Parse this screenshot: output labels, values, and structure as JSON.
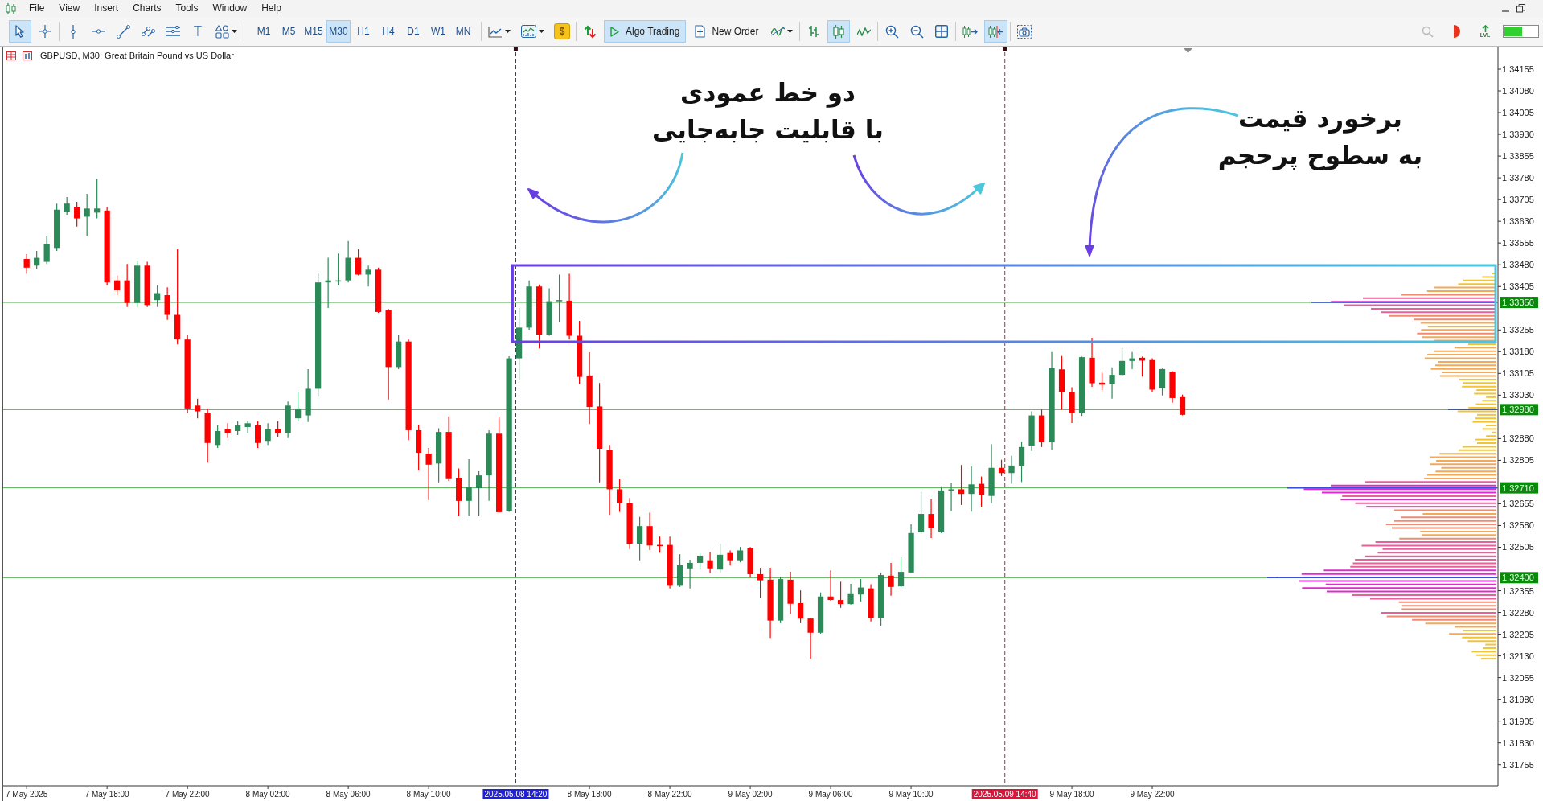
{
  "menu": {
    "items": [
      "File",
      "View",
      "Insert",
      "Charts",
      "Tools",
      "Window",
      "Help"
    ]
  },
  "toolbar": {
    "drawing_tools": [
      {
        "selected": true
      },
      {
        "selected": false
      },
      {
        "selected": false
      },
      {
        "selected": false
      },
      {
        "selected": false
      },
      {
        "selected": false
      },
      {
        "selected": false
      },
      {
        "selected": false,
        "glyph": "T"
      },
      {
        "selected": false
      }
    ],
    "timeframes": [
      {
        "label": "M1",
        "selected": false
      },
      {
        "label": "M5",
        "selected": false
      },
      {
        "label": "M15",
        "selected": false
      },
      {
        "label": "M30",
        "selected": true
      },
      {
        "label": "H1",
        "selected": false
      },
      {
        "label": "H4",
        "selected": false
      },
      {
        "label": "D1",
        "selected": false
      },
      {
        "label": "W1",
        "selected": false
      },
      {
        "label": "MN",
        "selected": false
      }
    ],
    "dollar_glyph": "$",
    "algo_trading": {
      "label": "Algo Trading",
      "on": true
    },
    "new_order": {
      "label": "New Order"
    },
    "chart_types": [
      {
        "selected": false
      },
      {
        "selected": true
      },
      {
        "selected": false
      }
    ],
    "scroll_tools": [
      {
        "on": false
      },
      {
        "on": true
      }
    ],
    "levels_label": "LVL"
  },
  "chart": {
    "title": "GBPUSD, M30: Great Britain Pound vs US Dollar",
    "chart_data": [
      {
        "type": "candlestick",
        "x": [
          "2025-05-07T14:00",
          "2025-05-07T14:30",
          "2025-05-07T15:00",
          "2025-05-07T15:30",
          "2025-05-07T16:00",
          "2025-05-07T16:30",
          "2025-05-07T17:00",
          "2025-05-07T17:30",
          "2025-05-07T18:00",
          "2025-05-07T18:30",
          "2025-05-07T19:00",
          "2025-05-07T19:30",
          "2025-05-07T20:00",
          "2025-05-07T20:30",
          "2025-05-07T21:00",
          "2025-05-07T21:30",
          "2025-05-07T22:00",
          "2025-05-07T22:30",
          "2025-05-07T23:00",
          "2025-05-07T23:30",
          "2025-05-08T00:00",
          "2025-05-08T00:30",
          "2025-05-08T01:00",
          "2025-05-08T01:30",
          "2025-05-08T02:00",
          "2025-05-08T02:30",
          "2025-05-08T03:00",
          "2025-05-08T03:30",
          "2025-05-08T04:00",
          "2025-05-08T04:30",
          "2025-05-08T05:00",
          "2025-05-08T05:30",
          "2025-05-08T06:00",
          "2025-05-08T06:30",
          "2025-05-08T07:00",
          "2025-05-08T07:30",
          "2025-05-08T08:00",
          "2025-05-08T08:30",
          "2025-05-08T09:00",
          "2025-05-08T09:30",
          "2025-05-08T10:00",
          "2025-05-08T10:30",
          "2025-05-08T11:00",
          "2025-05-08T11:30",
          "2025-05-08T12:00",
          "2025-05-08T12:30",
          "2025-05-08T13:00",
          "2025-05-08T13:30",
          "2025-05-08T14:00",
          "2025-05-08T14:30",
          "2025-05-08T15:00",
          "2025-05-08T15:30",
          "2025-05-08T16:00",
          "2025-05-08T16:30",
          "2025-05-08T17:00",
          "2025-05-08T17:30",
          "2025-05-08T18:00",
          "2025-05-08T18:30",
          "2025-05-08T19:00",
          "2025-05-08T19:30",
          "2025-05-08T20:00",
          "2025-05-08T20:30",
          "2025-05-08T21:00",
          "2025-05-08T21:30",
          "2025-05-08T22:00",
          "2025-05-08T22:30",
          "2025-05-08T23:00",
          "2025-05-08T23:30",
          "2025-05-09T00:00",
          "2025-05-09T00:30",
          "2025-05-09T01:00",
          "2025-05-09T01:30",
          "2025-05-09T02:00",
          "2025-05-09T02:30",
          "2025-05-09T03:00",
          "2025-05-09T03:30",
          "2025-05-09T04:00",
          "2025-05-09T04:30",
          "2025-05-09T05:00",
          "2025-05-09T05:30",
          "2025-05-09T06:00",
          "2025-05-09T06:30",
          "2025-05-09T07:00",
          "2025-05-09T07:30",
          "2025-05-09T08:00",
          "2025-05-09T08:30",
          "2025-05-09T09:00",
          "2025-05-09T09:30",
          "2025-05-09T10:00",
          "2025-05-09T10:30",
          "2025-05-09T11:00",
          "2025-05-09T11:30",
          "2025-05-09T12:00",
          "2025-05-09T12:30",
          "2025-05-09T13:00",
          "2025-05-09T13:30",
          "2025-05-09T14:00",
          "2025-05-09T14:30",
          "2025-05-09T15:00",
          "2025-05-09T15:30",
          "2025-05-09T16:00",
          "2025-05-09T16:30",
          "2025-05-09T17:00",
          "2025-05-09T17:30",
          "2025-05-09T18:00",
          "2025-05-09T18:30",
          "2025-05-09T19:00",
          "2025-05-09T19:30",
          "2025-05-09T20:00",
          "2025-05-09T20:30",
          "2025-05-09T21:00",
          "2025-05-09T21:30",
          "2025-05-09T22:00",
          "2025-05-09T22:30",
          "2025-05-09T23:00",
          "2025-05-09T23:30"
        ],
        "ohlc": [
          [
            1.335,
            1.33517,
            1.33449,
            1.3347
          ],
          [
            1.33477,
            1.33528,
            1.33466,
            1.33504
          ],
          [
            1.3349,
            1.33578,
            1.33483,
            1.33551
          ],
          [
            1.33538,
            1.33691,
            1.33528,
            1.3367
          ],
          [
            1.33663,
            1.33714,
            1.33653,
            1.33691
          ],
          [
            1.3368,
            1.33697,
            1.33612,
            1.3364
          ],
          [
            1.33646,
            1.33725,
            1.33578,
            1.33674
          ],
          [
            1.3366,
            1.33776,
            1.3364,
            1.33674
          ],
          [
            1.33667,
            1.3368,
            1.33409,
            1.33419
          ],
          [
            1.33426,
            1.33443,
            1.33375,
            1.33392
          ],
          [
            1.33426,
            1.33483,
            1.33334,
            1.33348
          ],
          [
            1.33348,
            1.33494,
            1.33334,
            1.33477
          ],
          [
            1.33477,
            1.3349,
            1.33334,
            1.33341
          ],
          [
            1.33358,
            1.33409,
            1.33334,
            1.33382
          ],
          [
            1.33375,
            1.33402,
            1.3329,
            1.33307
          ],
          [
            1.33307,
            1.33534,
            1.33205,
            1.33222
          ],
          [
            1.33222,
            1.33239,
            1.32967,
            1.32984
          ],
          [
            1.32994,
            1.33018,
            1.3295,
            1.32974
          ],
          [
            1.32967,
            1.32984,
            1.32797,
            1.32865
          ],
          [
            1.32858,
            1.32926,
            1.32848,
            1.32906
          ],
          [
            1.32913,
            1.32933,
            1.32882,
            1.32899
          ],
          [
            1.32906,
            1.3294,
            1.32892,
            1.32926
          ],
          [
            1.3292,
            1.3294,
            1.32899,
            1.32933
          ],
          [
            1.32926,
            1.3294,
            1.32848,
            1.32865
          ],
          [
            1.32872,
            1.32933,
            1.32858,
            1.32913
          ],
          [
            1.32913,
            1.3294,
            1.32886,
            1.32899
          ],
          [
            1.32899,
            1.33008,
            1.32882,
            1.32994
          ],
          [
            1.3295,
            1.33042,
            1.3294,
            1.32984
          ],
          [
            1.3296,
            1.3312,
            1.32937,
            1.33052
          ],
          [
            1.33052,
            1.33453,
            1.33025,
            1.33419
          ],
          [
            1.33419,
            1.33504,
            1.33331,
            1.33426
          ],
          [
            1.33422,
            1.33519,
            1.33409,
            1.33426
          ],
          [
            1.33426,
            1.33562,
            1.33419,
            1.33504
          ],
          [
            1.33504,
            1.33534,
            1.33443,
            1.33446
          ],
          [
            1.33446,
            1.33477,
            1.33405,
            1.33463
          ],
          [
            1.33463,
            1.3347,
            1.33314,
            1.33317
          ],
          [
            1.33324,
            1.33327,
            1.33015,
            1.33127
          ],
          [
            1.33127,
            1.33239,
            1.3312,
            1.33215
          ],
          [
            1.33215,
            1.33222,
            1.32875,
            1.32909
          ],
          [
            1.32909,
            1.32928,
            1.3277,
            1.32831
          ],
          [
            1.32828,
            1.32848,
            1.32668,
            1.3279
          ],
          [
            1.32794,
            1.32916,
            1.32729,
            1.32903
          ],
          [
            1.32903,
            1.32957,
            1.32733,
            1.32743
          ],
          [
            1.32745,
            1.32777,
            1.32612,
            1.32665
          ],
          [
            1.32665,
            1.32809,
            1.32612,
            1.32712
          ],
          [
            1.32709,
            1.32767,
            1.32612,
            1.32753
          ],
          [
            1.32753,
            1.32909,
            1.32665,
            1.32897
          ],
          [
            1.32897,
            1.32954,
            1.32624,
            1.32626
          ],
          [
            1.32631,
            1.33164,
            1.32627,
            1.33157
          ],
          [
            1.33157,
            1.33331,
            1.33083,
            1.33263
          ],
          [
            1.33263,
            1.33426,
            1.33256,
            1.33405
          ],
          [
            1.33405,
            1.33412,
            1.33191,
            1.33239
          ],
          [
            1.33239,
            1.33399,
            1.33235,
            1.33354
          ],
          [
            1.33354,
            1.33446,
            1.33283,
            1.33358
          ],
          [
            1.33356,
            1.33449,
            1.33222,
            1.33235
          ],
          [
            1.33235,
            1.33286,
            1.33067,
            1.33093
          ],
          [
            1.33098,
            1.33178,
            1.3293,
            1.32989
          ],
          [
            1.32991,
            1.33072,
            1.32729,
            1.32845
          ],
          [
            1.32841,
            1.32858,
            1.32617,
            1.32705
          ],
          [
            1.32705,
            1.3274,
            1.32627,
            1.32657
          ],
          [
            1.32657,
            1.32675,
            1.32499,
            1.32517
          ],
          [
            1.32517,
            1.3261,
            1.3246,
            1.32578
          ],
          [
            1.32578,
            1.32624,
            1.32495,
            1.32511
          ],
          [
            1.32513,
            1.32542,
            1.32486,
            1.32512
          ],
          [
            1.32513,
            1.32542,
            1.32363,
            1.32372
          ],
          [
            1.32372,
            1.32481,
            1.32368,
            1.32443
          ],
          [
            1.32432,
            1.32462,
            1.32363,
            1.32451
          ],
          [
            1.32451,
            1.32483,
            1.32428,
            1.32476
          ],
          [
            1.3246,
            1.32488,
            1.32416,
            1.32432
          ],
          [
            1.32428,
            1.32517,
            1.32418,
            1.32479
          ],
          [
            1.32485,
            1.32494,
            1.32442,
            1.3246
          ],
          [
            1.3246,
            1.32506,
            1.32453,
            1.32494
          ],
          [
            1.32502,
            1.32506,
            1.324,
            1.32412
          ],
          [
            1.32412,
            1.32434,
            1.32329,
            1.32391
          ],
          [
            1.32393,
            1.32434,
            1.32192,
            1.32252
          ],
          [
            1.32252,
            1.32402,
            1.32243,
            1.32395
          ],
          [
            1.32393,
            1.3242,
            1.32275,
            1.3231
          ],
          [
            1.32312,
            1.32356,
            1.32243,
            1.32259
          ],
          [
            1.32259,
            1.32262,
            1.3212,
            1.3221
          ],
          [
            1.3221,
            1.32349,
            1.32207,
            1.32335
          ],
          [
            1.32335,
            1.32425,
            1.32321,
            1.32323
          ],
          [
            1.32323,
            1.32386,
            1.32296,
            1.32309
          ],
          [
            1.32309,
            1.32379,
            1.32307,
            1.32346
          ],
          [
            1.32342,
            1.32395,
            1.32317,
            1.32366
          ],
          [
            1.32363,
            1.32377,
            1.32249,
            1.32261
          ],
          [
            1.32261,
            1.32418,
            1.32234,
            1.32409
          ],
          [
            1.32407,
            1.32451,
            1.32338,
            1.32368
          ],
          [
            1.3237,
            1.32471,
            1.32368,
            1.3242
          ],
          [
            1.32418,
            1.32585,
            1.32416,
            1.32554
          ],
          [
            1.32557,
            1.32696,
            1.32553,
            1.3262
          ],
          [
            1.3262,
            1.3267,
            1.32537,
            1.32571
          ],
          [
            1.32559,
            1.32715,
            1.32554,
            1.32701
          ],
          [
            1.32703,
            1.32726,
            1.3263,
            1.32705
          ],
          [
            1.32705,
            1.32789,
            1.32651,
            1.32689
          ],
          [
            1.32689,
            1.32784,
            1.32628,
            1.32722
          ],
          [
            1.32724,
            1.32749,
            1.32645,
            1.32685
          ],
          [
            1.32682,
            1.3286,
            1.32657,
            1.32779
          ],
          [
            1.32779,
            1.32807,
            1.32751,
            1.32761
          ],
          [
            1.32761,
            1.32821,
            1.32724,
            1.32787
          ],
          [
            1.32784,
            1.32869,
            1.3273,
            1.32851
          ],
          [
            1.32856,
            1.32974,
            1.32837,
            1.3296
          ],
          [
            1.3296,
            1.3298,
            1.32851,
            1.32867
          ],
          [
            1.32867,
            1.33179,
            1.32841,
            1.33123
          ],
          [
            1.33119,
            1.33165,
            1.3298,
            1.33041
          ],
          [
            1.3304,
            1.33057,
            1.32934,
            1.32967
          ],
          [
            1.32967,
            1.33163,
            1.32958,
            1.33161
          ],
          [
            1.33159,
            1.33228,
            1.33059,
            1.33071
          ],
          [
            1.33073,
            1.33108,
            1.33048,
            1.33066
          ],
          [
            1.33068,
            1.33126,
            1.33018,
            1.331
          ],
          [
            1.331,
            1.33193,
            1.33098,
            1.33148
          ],
          [
            1.33148,
            1.33179,
            1.3312,
            1.33157
          ],
          [
            1.33159,
            1.33163,
            1.33094,
            1.33149
          ],
          [
            1.33151,
            1.33157,
            1.33041,
            1.33049
          ],
          [
            1.33054,
            1.33122,
            1.33029,
            1.3312
          ],
          [
            1.33111,
            1.33113,
            1.33004,
            1.3302
          ],
          [
            1.33023,
            1.33032,
            1.3296,
            1.32962
          ]
        ],
        "xlim": [
          "2025-05-07T12:50",
          "2025-05-10T15:12"
        ],
        "ylim": [
          1.31682,
          1.3423
        ],
        "yticks": [
          {
            "value": 1.34155,
            "label": "1.34155"
          },
          {
            "value": 1.3408,
            "label": "1.34080"
          },
          {
            "value": 1.34005,
            "label": "1.34005"
          },
          {
            "value": 1.3393,
            "label": "1.33930"
          },
          {
            "value": 1.33855,
            "label": "1.33855"
          },
          {
            "value": 1.3378,
            "label": "1.33780"
          },
          {
            "value": 1.33705,
            "label": "1.33705"
          },
          {
            "value": 1.3363,
            "label": "1.33630"
          },
          {
            "value": 1.33555,
            "label": "1.33555"
          },
          {
            "value": 1.3348,
            "label": "1.33480"
          },
          {
            "value": 1.33405,
            "label": "1.33405"
          },
          {
            "value": 1.33255,
            "label": "1.33255"
          },
          {
            "value": 1.3318,
            "label": "1.33180"
          },
          {
            "value": 1.33105,
            "label": "1.33105"
          },
          {
            "value": 1.3303,
            "label": "1.33030"
          },
          {
            "value": 1.3288,
            "label": "1.32880"
          },
          {
            "value": 1.32805,
            "label": "1.32805"
          },
          {
            "value": 1.32655,
            "label": "1.32655"
          },
          {
            "value": 1.3258,
            "label": "1.32580"
          },
          {
            "value": 1.32505,
            "label": "1.32505"
          },
          {
            "value": 1.32355,
            "label": "1.32355"
          },
          {
            "value": 1.3228,
            "label": "1.32280"
          },
          {
            "value": 1.32205,
            "label": "1.32205"
          },
          {
            "value": 1.3213,
            "label": "1.32130"
          },
          {
            "value": 1.32055,
            "label": "1.32055"
          },
          {
            "value": 1.3198,
            "label": "1.31980"
          },
          {
            "value": 1.31905,
            "label": "1.31905"
          },
          {
            "value": 1.3183,
            "label": "1.31830"
          },
          {
            "value": 1.31755,
            "label": "1.31755"
          }
        ],
        "xticks": [
          {
            "value": "2025-05-07T14:00",
            "label": "7 May 2025"
          },
          {
            "value": "2025-05-07T18:00",
            "label": "7 May 18:00"
          },
          {
            "value": "2025-05-07T22:00",
            "label": "7 May 22:00"
          },
          {
            "value": "2025-05-08T02:00",
            "label": "8 May 02:00"
          },
          {
            "value": "2025-05-08T06:00",
            "label": "8 May 06:00"
          },
          {
            "value": "2025-05-08T10:00",
            "label": "8 May 10:00"
          },
          {
            "value": "2025-05-08T18:00",
            "label": "8 May 18:00"
          },
          {
            "value": "2025-05-08T22:00",
            "label": "8 May 22:00"
          },
          {
            "value": "2025-05-09T02:00",
            "label": "9 May 02:00"
          },
          {
            "value": "2025-05-09T06:00",
            "label": "9 May 06:00"
          },
          {
            "value": "2025-05-09T10:00",
            "label": "9 May 10:00"
          },
          {
            "value": "2025-05-09T18:00",
            "label": "9 May 18:00"
          },
          {
            "value": "2025-05-09T22:00",
            "label": "9 May 22:00"
          }
        ],
        "ref_lines": [
          {
            "axis": "y",
            "value": 1.3335,
            "label": "1.33350",
            "color": "#0a8a0a",
            "line_style": "solid"
          },
          {
            "axis": "y",
            "value": 1.3298,
            "label": "1.32980",
            "color": "#0a8a0a",
            "line_style": "solid"
          },
          {
            "axis": "y",
            "value": 1.3271,
            "label": "1.32710",
            "color": "#0a8a0a",
            "line_style": "solid"
          },
          {
            "axis": "y",
            "value": 1.324,
            "label": "1.32400",
            "color": "#0a8a0a",
            "line_style": "solid"
          },
          {
            "axis": "x",
            "value": "2025-05-08T14:20",
            "label": "2025.05.08 14:20",
            "color": "#2020d8",
            "line_style": "dashed"
          },
          {
            "axis": "x",
            "value": "2025-05-09T14:40",
            "label": "2025.05.09 14:40",
            "color": "#dc143c",
            "line_style": "dashed"
          }
        ],
        "annotations": [
          "دو خط عمودی\nبا قابلیت جابه‌جایی",
          "برخورد قیمت\nبه سطوح پرحجم"
        ]
      }
    ]
  }
}
